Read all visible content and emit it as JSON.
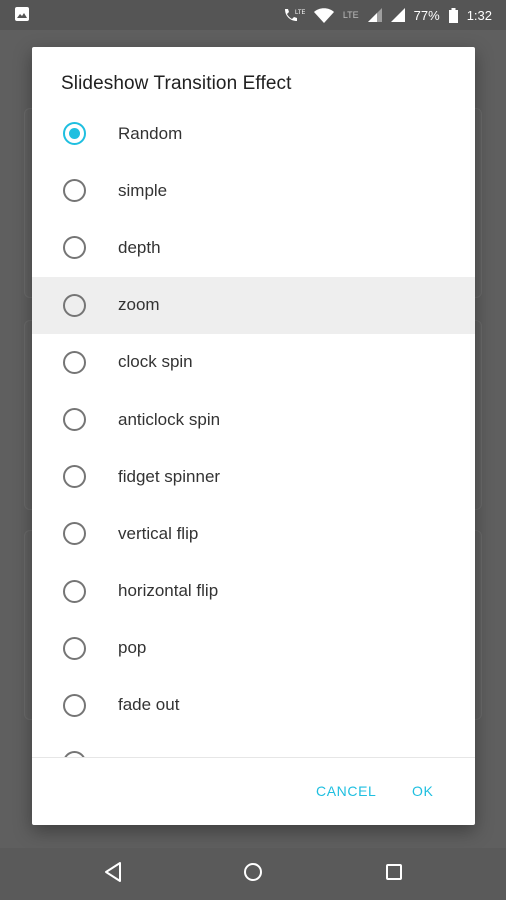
{
  "status_bar": {
    "image_icon": "image-icon",
    "call_icon": "wifi-calling-lte-icon",
    "lte_badge": "LTE",
    "wifi_icon": "wifi-icon",
    "signal_icons": [
      "signal-icon",
      "signal-icon"
    ],
    "battery_percent": "77%",
    "battery_icon": "battery-icon",
    "time": "1:32"
  },
  "dialog": {
    "title": "Slideshow Transition Effect",
    "options": [
      {
        "label": "Random",
        "selected": true
      },
      {
        "label": "simple",
        "selected": false
      },
      {
        "label": "depth",
        "selected": false
      },
      {
        "label": "zoom",
        "selected": false,
        "pressed": true
      },
      {
        "label": "clock spin",
        "selected": false
      },
      {
        "label": "anticlock spin",
        "selected": false
      },
      {
        "label": "fidget spinner",
        "selected": false
      },
      {
        "label": "vertical flip",
        "selected": false
      },
      {
        "label": "horizontal flip",
        "selected": false
      },
      {
        "label": "pop",
        "selected": false
      },
      {
        "label": "fade out",
        "selected": false
      },
      {
        "label": "",
        "selected": false
      }
    ],
    "cancel_label": "CANCEL",
    "ok_label": "OK"
  },
  "nav_bar": {
    "back_icon": "back-triangle-icon",
    "home_icon": "home-circle-icon",
    "recents_icon": "recents-square-icon"
  },
  "colors": {
    "accent": "#1fbfe0",
    "scrim": "#5d5d5d"
  }
}
